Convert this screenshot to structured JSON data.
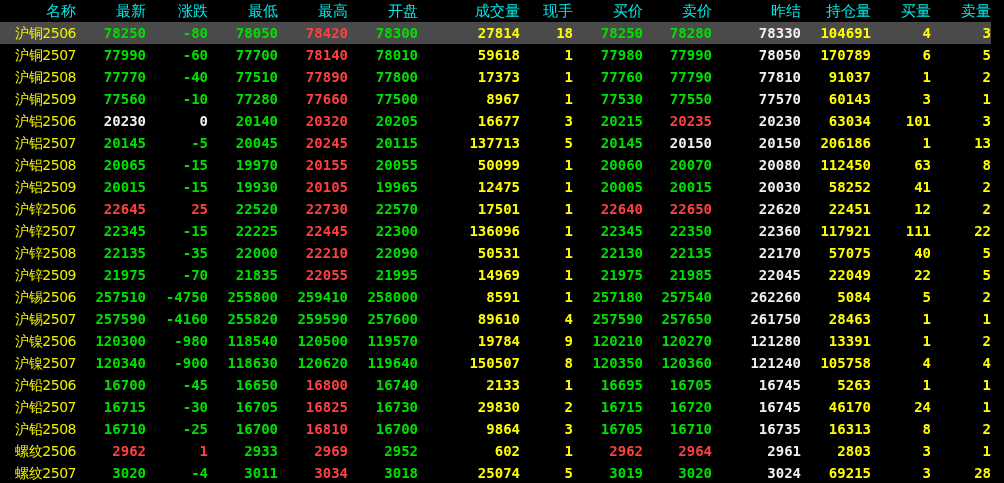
{
  "table": {
    "columns": [
      {
        "label": "名称",
        "kind": "name"
      },
      {
        "label": "最新",
        "kind": "price"
      },
      {
        "label": "涨跌",
        "kind": "change"
      },
      {
        "label": "最低",
        "kind": "price"
      },
      {
        "label": "最高",
        "kind": "price"
      },
      {
        "label": "开盘",
        "kind": "price"
      },
      {
        "label": "成交量",
        "kind": "volume"
      },
      {
        "label": "现手",
        "kind": "volume"
      },
      {
        "label": "买价",
        "kind": "price"
      },
      {
        "label": "卖价",
        "kind": "price"
      },
      {
        "label": "昨结",
        "kind": "prev"
      },
      {
        "label": "持仓量",
        "kind": "volume"
      },
      {
        "label": "买量",
        "kind": "volume"
      },
      {
        "label": "卖量",
        "kind": "volume"
      }
    ],
    "rows": [
      {
        "selected": true,
        "cells": [
          "沪铜2506",
          "78250",
          "-80",
          "78050",
          "78420",
          "78300",
          "27814",
          "18",
          "78250",
          "78280",
          "78330",
          "104691",
          "4",
          "3"
        ]
      },
      {
        "selected": false,
        "cells": [
          "沪铜2507",
          "77990",
          "-60",
          "77700",
          "78140",
          "78010",
          "59618",
          "1",
          "77980",
          "77990",
          "78050",
          "170789",
          "6",
          "5"
        ]
      },
      {
        "selected": false,
        "cells": [
          "沪铜2508",
          "77770",
          "-40",
          "77510",
          "77890",
          "77800",
          "17373",
          "1",
          "77760",
          "77790",
          "77810",
          "91037",
          "1",
          "2"
        ]
      },
      {
        "selected": false,
        "cells": [
          "沪铜2509",
          "77560",
          "-10",
          "77280",
          "77660",
          "77500",
          "8967",
          "1",
          "77530",
          "77550",
          "77570",
          "60143",
          "3",
          "1"
        ]
      },
      {
        "selected": false,
        "cells": [
          "沪铝2506",
          "20230",
          "0",
          "20140",
          "20320",
          "20205",
          "16677",
          "3",
          "20215",
          "20235",
          "20230",
          "63034",
          "101",
          "3"
        ]
      },
      {
        "selected": false,
        "cells": [
          "沪铝2507",
          "20145",
          "-5",
          "20045",
          "20245",
          "20115",
          "137713",
          "5",
          "20145",
          "20150",
          "20150",
          "206186",
          "1",
          "13"
        ]
      },
      {
        "selected": false,
        "cells": [
          "沪铝2508",
          "20065",
          "-15",
          "19970",
          "20155",
          "20055",
          "50099",
          "1",
          "20060",
          "20070",
          "20080",
          "112450",
          "63",
          "8"
        ]
      },
      {
        "selected": false,
        "cells": [
          "沪铝2509",
          "20015",
          "-15",
          "19930",
          "20105",
          "19965",
          "12475",
          "1",
          "20005",
          "20015",
          "20030",
          "58252",
          "41",
          "2"
        ]
      },
      {
        "selected": false,
        "cells": [
          "沪锌2506",
          "22645",
          "25",
          "22520",
          "22730",
          "22570",
          "17501",
          "1",
          "22640",
          "22650",
          "22620",
          "22451",
          "12",
          "2"
        ]
      },
      {
        "selected": false,
        "cells": [
          "沪锌2507",
          "22345",
          "-15",
          "22225",
          "22445",
          "22300",
          "136096",
          "1",
          "22345",
          "22350",
          "22360",
          "117921",
          "111",
          "22"
        ]
      },
      {
        "selected": false,
        "cells": [
          "沪锌2508",
          "22135",
          "-35",
          "22000",
          "22210",
          "22090",
          "50531",
          "1",
          "22130",
          "22135",
          "22170",
          "57075",
          "40",
          "5"
        ]
      },
      {
        "selected": false,
        "cells": [
          "沪锌2509",
          "21975",
          "-70",
          "21835",
          "22055",
          "21995",
          "14969",
          "1",
          "21975",
          "21985",
          "22045",
          "22049",
          "22",
          "5"
        ]
      },
      {
        "selected": false,
        "cells": [
          "沪锡2506",
          "257510",
          "-4750",
          "255800",
          "259410",
          "258000",
          "8591",
          "1",
          "257180",
          "257540",
          "262260",
          "5084",
          "5",
          "2"
        ]
      },
      {
        "selected": false,
        "cells": [
          "沪锡2507",
          "257590",
          "-4160",
          "255820",
          "259590",
          "257600",
          "89610",
          "4",
          "257590",
          "257650",
          "261750",
          "28463",
          "1",
          "1"
        ]
      },
      {
        "selected": false,
        "cells": [
          "沪镍2506",
          "120300",
          "-980",
          "118540",
          "120500",
          "119570",
          "19784",
          "9",
          "120210",
          "120270",
          "121280",
          "13391",
          "1",
          "2"
        ]
      },
      {
        "selected": false,
        "cells": [
          "沪镍2507",
          "120340",
          "-900",
          "118630",
          "120620",
          "119640",
          "150507",
          "8",
          "120350",
          "120360",
          "121240",
          "105758",
          "4",
          "4"
        ]
      },
      {
        "selected": false,
        "cells": [
          "沪铅2506",
          "16700",
          "-45",
          "16650",
          "16800",
          "16740",
          "2133",
          "1",
          "16695",
          "16705",
          "16745",
          "5263",
          "1",
          "1"
        ]
      },
      {
        "selected": false,
        "cells": [
          "沪铅2507",
          "16715",
          "-30",
          "16705",
          "16825",
          "16730",
          "29830",
          "2",
          "16715",
          "16720",
          "16745",
          "46170",
          "24",
          "1"
        ]
      },
      {
        "selected": false,
        "cells": [
          "沪铅2508",
          "16710",
          "-25",
          "16700",
          "16810",
          "16700",
          "9864",
          "3",
          "16705",
          "16710",
          "16735",
          "16313",
          "8",
          "2"
        ]
      },
      {
        "selected": false,
        "cells": [
          "螺纹2506",
          "2962",
          "1",
          "2933",
          "2969",
          "2952",
          "602",
          "1",
          "2962",
          "2964",
          "2961",
          "2803",
          "3",
          "1"
        ]
      },
      {
        "selected": false,
        "cells": [
          "螺纹2507",
          "3020",
          "-4",
          "3011",
          "3034",
          "3018",
          "25074",
          "5",
          "3019",
          "3020",
          "3024",
          "69215",
          "3",
          "28"
        ]
      }
    ]
  }
}
